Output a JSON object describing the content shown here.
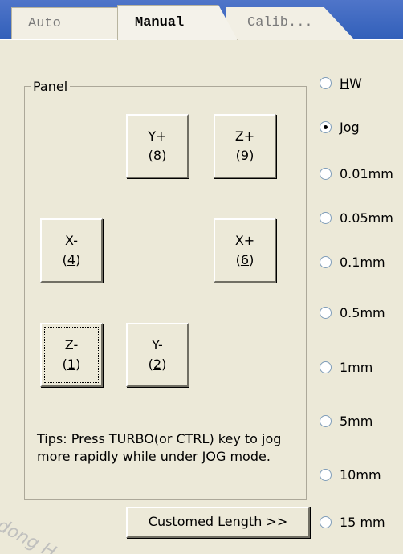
{
  "tabs": [
    {
      "label": "Auto"
    },
    {
      "label": "Manual"
    },
    {
      "label": "Calib..."
    }
  ],
  "panel": {
    "title": "Panel",
    "buttons": {
      "y_plus": {
        "label": "Y+",
        "key": "8"
      },
      "z_plus": {
        "label": "Z+",
        "key": "9"
      },
      "x_minus": {
        "label": "X-",
        "key": "4"
      },
      "x_plus": {
        "label": "X+",
        "key": "6"
      },
      "z_minus": {
        "label": "Z-",
        "key": "1"
      },
      "y_minus": {
        "label": "Y-",
        "key": "2"
      }
    },
    "tips": "Tips: Press TURBO(or CTRL) key to jog more rapidly while under JOG mode."
  },
  "customed_length_button": "Customed Length  >>",
  "step_modes": {
    "selected": "Jog",
    "options": [
      {
        "accel": "H",
        "rest": "W"
      },
      {
        "accel": "J",
        "rest": "og"
      },
      {
        "accel": "",
        "rest": "0.01mm"
      },
      {
        "accel": "",
        "rest": "0.05mm"
      },
      {
        "accel": "",
        "rest": "0.1mm"
      },
      {
        "accel": "",
        "rest": "0.5mm"
      },
      {
        "accel": "",
        "rest": "1mm"
      },
      {
        "accel": "",
        "rest": "5mm"
      },
      {
        "accel": "",
        "rest": "10mm"
      },
      {
        "accel": "",
        "rest": "15 mm"
      }
    ]
  },
  "watermark": "dong H"
}
